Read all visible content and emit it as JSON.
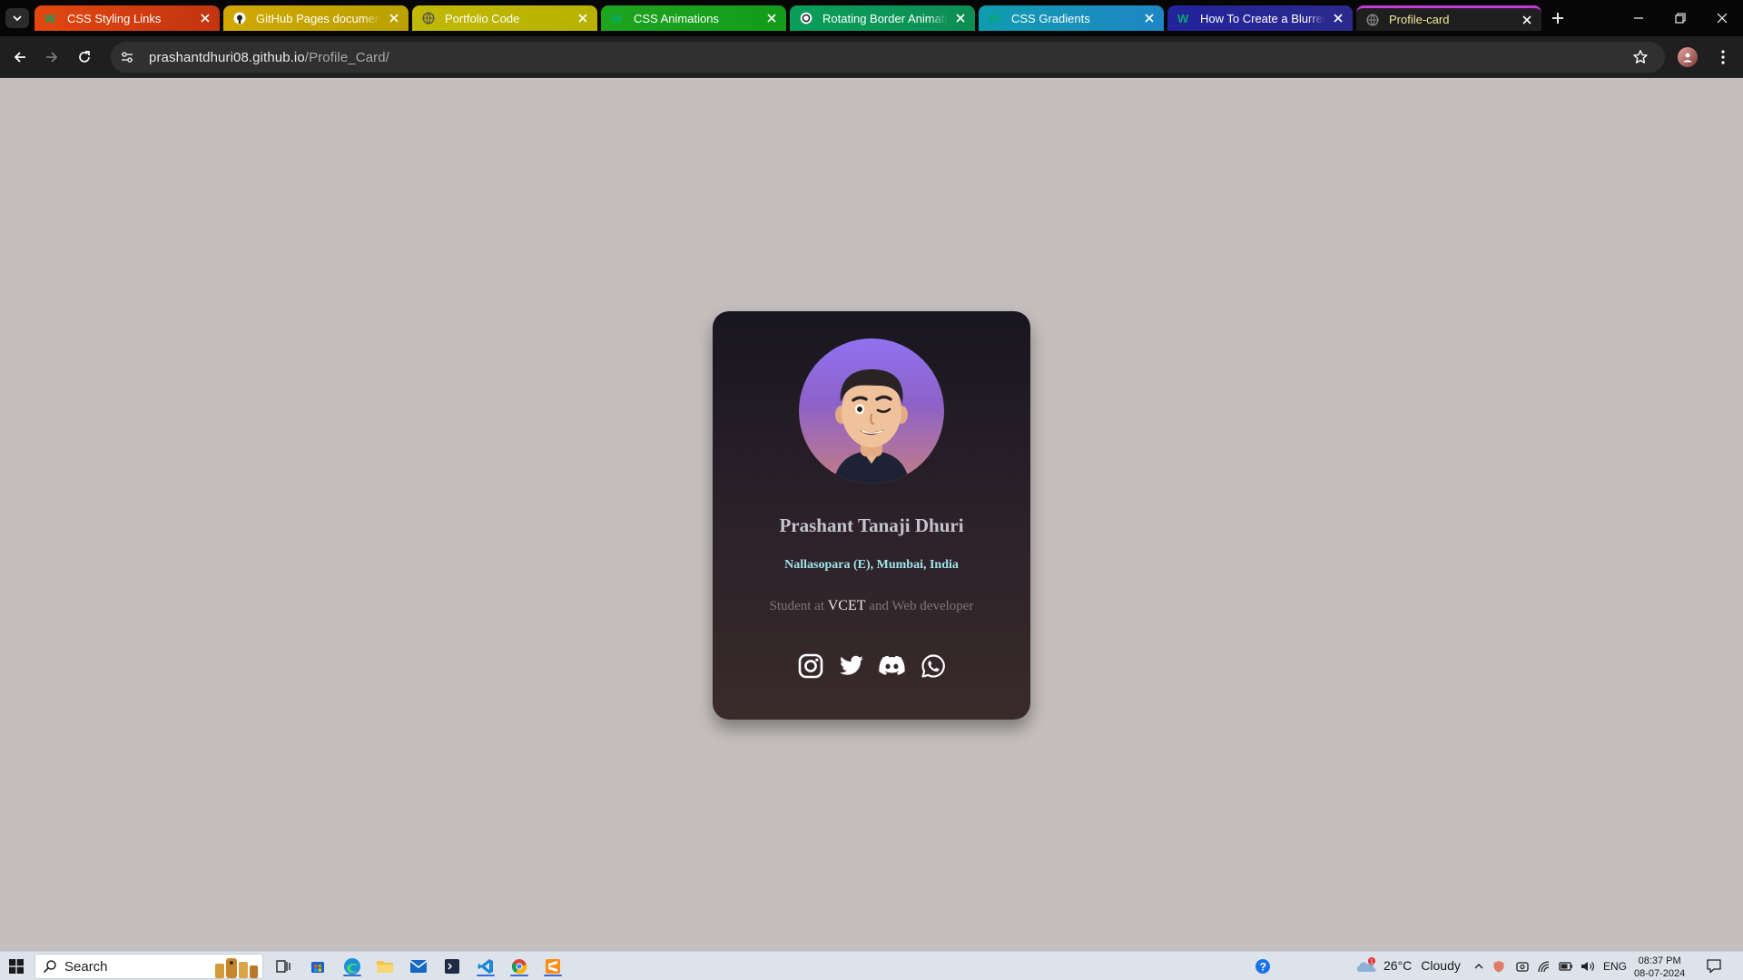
{
  "browser": {
    "tabs": [
      {
        "title": "CSS Styling Links",
        "color": "#d4370f",
        "active": false
      },
      {
        "title": "GitHub Pages documenta",
        "color": "#c7b000",
        "active": false
      },
      {
        "title": "Portfolio Code",
        "color": "#c7b000",
        "active": false
      },
      {
        "title": "CSS Animations",
        "color": "#1e9e1e",
        "active": false
      },
      {
        "title": "Rotating Border Animatio",
        "color": "#0d9a55",
        "active": false
      },
      {
        "title": "CSS Gradients",
        "color": "#1d8fb5",
        "active": false
      },
      {
        "title": "How To Create a Blurred I",
        "color": "#2a2aa0",
        "active": false
      },
      {
        "title": "Profile-card",
        "color": "#1f1f1f",
        "active": true
      }
    ],
    "url_host": "prashantdhuri08.github.io",
    "url_path": "/Profile_Card/"
  },
  "card": {
    "name": "Prashant Tanaji Dhuri",
    "location": "Nallasopara (E), Mumbai, India",
    "bio_pre": "Student at ",
    "bio_highlight": "VCET",
    "bio_post": " and Web developer",
    "socials": [
      "instagram-icon",
      "twitter-icon",
      "discord-icon",
      "whatsapp-icon"
    ]
  },
  "taskbar": {
    "search_label": "Search",
    "weather_temp": "26°C",
    "weather_text": "Cloudy",
    "weather_badge": "1",
    "language": "ENG",
    "time": "08:37 PM",
    "date": "08-07-2024"
  }
}
